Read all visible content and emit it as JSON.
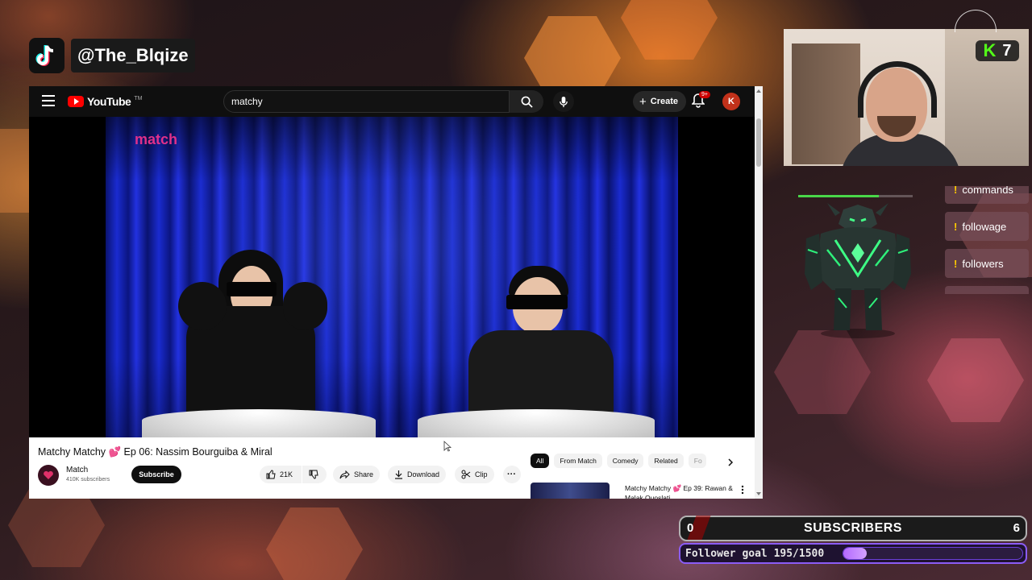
{
  "overlay": {
    "tiktok_handle": "@The_Blqize",
    "kick_count": "7",
    "commands": [
      "commands",
      "followage",
      "followers"
    ],
    "subscribers": {
      "label": "SUBSCRIBERS",
      "left_value": "0",
      "right_value": "6"
    },
    "follower_goal": {
      "text": "Follower goal 195/1500",
      "current": 195,
      "target": 1500
    },
    "colors": {
      "kick_green": "#53fc18",
      "goal_purple": "#8b5cf6",
      "youtube_red": "#ff0000"
    }
  },
  "youtube": {
    "logo_text": "YouTube",
    "logo_tm": "TM",
    "search_value": "matchy",
    "create_label": "Create",
    "notification_badge": "9+",
    "avatar_letter": "K",
    "video": {
      "brand_logo": "match",
      "title": "Matchy Matchy 💕 Ep 06: Nassim Bourguiba & Miral",
      "channel": "Match",
      "subscribers": "410K subscribers",
      "subscribe_label": "Subscribe",
      "likes": "21K",
      "share_label": "Share",
      "download_label": "Download",
      "clip_label": "Clip"
    },
    "chips": [
      "All",
      "From Match",
      "Comedy",
      "Related",
      "Fo"
    ],
    "recommendation": {
      "title": "Matchy Matchy 💕 Ep 39: Rawan & Malak Quoslati"
    }
  }
}
